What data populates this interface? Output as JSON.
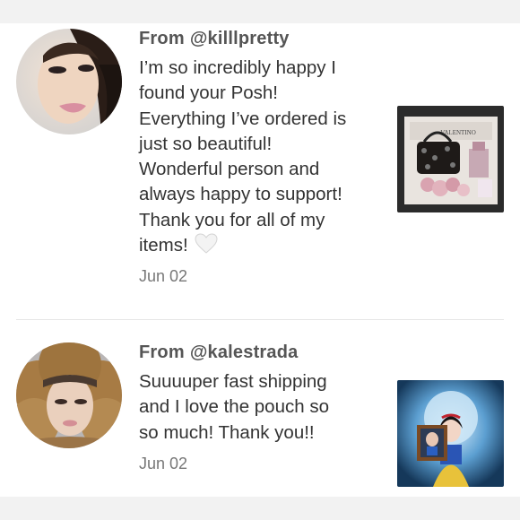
{
  "reviews": [
    {
      "from_label": "From",
      "handle": "@killlpretty",
      "lines": [
        "I’m so incredibly happy I",
        "found your Posh!",
        "Everything I’ve ordered is",
        "just so beautiful!",
        "Wonderful person and",
        "always happy to support!",
        "Thank you for all of my",
        "items!"
      ],
      "date": "Jun 02",
      "thumb_brand": "VALENTINO"
    },
    {
      "from_label": "From",
      "handle": "@kalestrada",
      "lines": [
        "Suuuuper fast shipping",
        "and I love the pouch so",
        "so much! Thank you!!"
      ],
      "date": "Jun 02"
    }
  ],
  "icons": {
    "heart": "white-heart-icon"
  },
  "colors": {
    "text": "#333333",
    "muted": "#777777",
    "divider": "#e6e6e6",
    "background": "#f2f2f2"
  }
}
